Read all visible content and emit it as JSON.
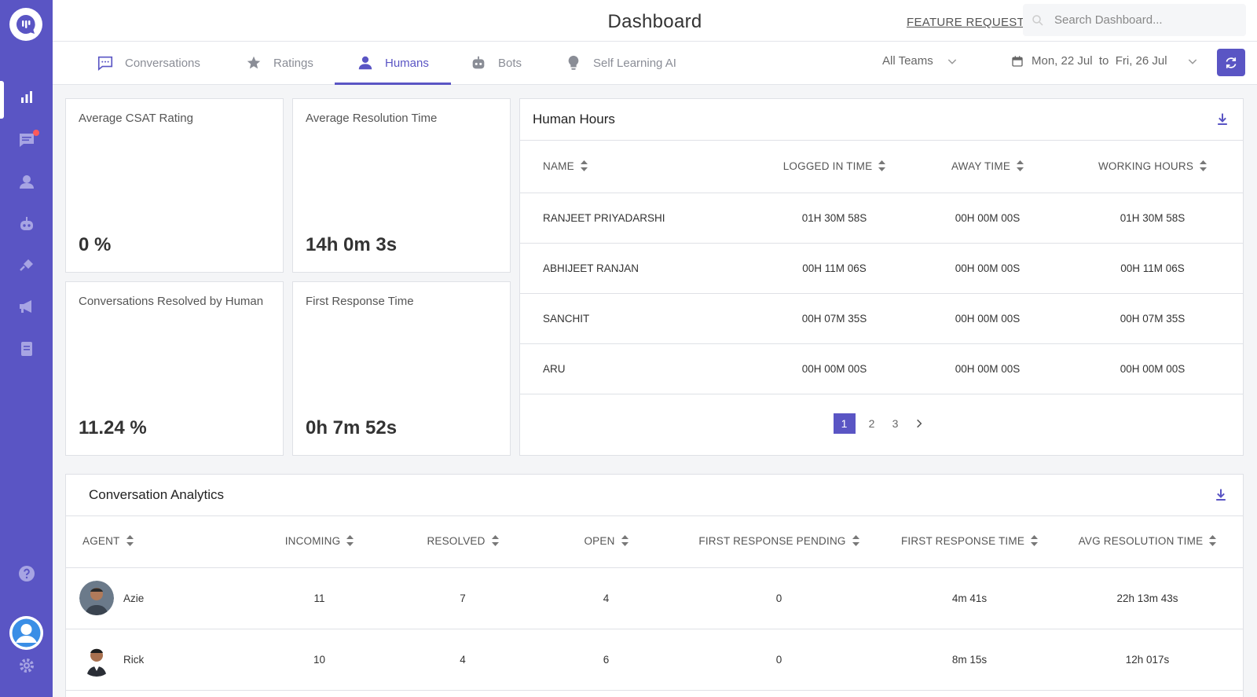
{
  "header": {
    "title": "Dashboard",
    "feature_request": "FEATURE REQUEST",
    "search_placeholder": "Search Dashboard..."
  },
  "tabs": [
    {
      "label": "Conversations",
      "icon": "chat-icon"
    },
    {
      "label": "Ratings",
      "icon": "star-icon"
    },
    {
      "label": "Humans",
      "icon": "person-icon",
      "active": true
    },
    {
      "label": "Bots",
      "icon": "robot-icon"
    },
    {
      "label": "Self Learning AI",
      "icon": "lightbulb-icon"
    }
  ],
  "filters": {
    "team": "All Teams",
    "date_range": "Mon, 22 Jul  to  Fri, 26 Jul"
  },
  "stats": {
    "csat": {
      "label": "Average CSAT Rating",
      "value": "0 %"
    },
    "resolution": {
      "label": "Average Resolution Time",
      "value": "14h 0m 3s"
    },
    "resolved_by_human": {
      "label": "Conversations Resolved by Human",
      "value": "11.24 %"
    },
    "first_response": {
      "label": "First Response Time",
      "value": "0h 7m 52s"
    }
  },
  "human_hours": {
    "title": "Human Hours",
    "columns": [
      "NAME",
      "LOGGED IN TIME",
      "AWAY TIME",
      "WORKING HOURS"
    ],
    "rows": [
      [
        "RANJEET PRIYADARSHI",
        "01H 30M 58S",
        "00H 00M 00S",
        "01H 30M 58S"
      ],
      [
        "ABHIJEET RANJAN",
        "00H 11M 06S",
        "00H 00M 00S",
        "00H 11M 06S"
      ],
      [
        "SANCHIT",
        "00H 07M 35S",
        "00H 00M 00S",
        "00H 07M 35S"
      ],
      [
        "ARU",
        "00H 00M 00S",
        "00H 00M 00S",
        "00H 00M 00S"
      ]
    ],
    "pages": [
      "1",
      "2",
      "3"
    ],
    "current_page": "1"
  },
  "conversation_analytics": {
    "title": "Conversation Analytics",
    "columns": [
      "AGENT",
      "INCOMING",
      "RESOLVED",
      "OPEN",
      "FIRST RESPONSE PENDING",
      "FIRST RESPONSE TIME",
      "AVG RESOLUTION TIME"
    ],
    "rows": [
      {
        "agent": "Azie",
        "incoming": "11",
        "resolved": "7",
        "open": "4",
        "pending": "0",
        "frt": "4m 41s",
        "art": "22h 13m 43s"
      },
      {
        "agent": "Rick",
        "incoming": "10",
        "resolved": "4",
        "open": "6",
        "pending": "0",
        "frt": "8m 15s",
        "art": "12h 017s"
      }
    ]
  },
  "colors": {
    "accent": "#5a55c4",
    "notification": "#ff5a5a"
  }
}
